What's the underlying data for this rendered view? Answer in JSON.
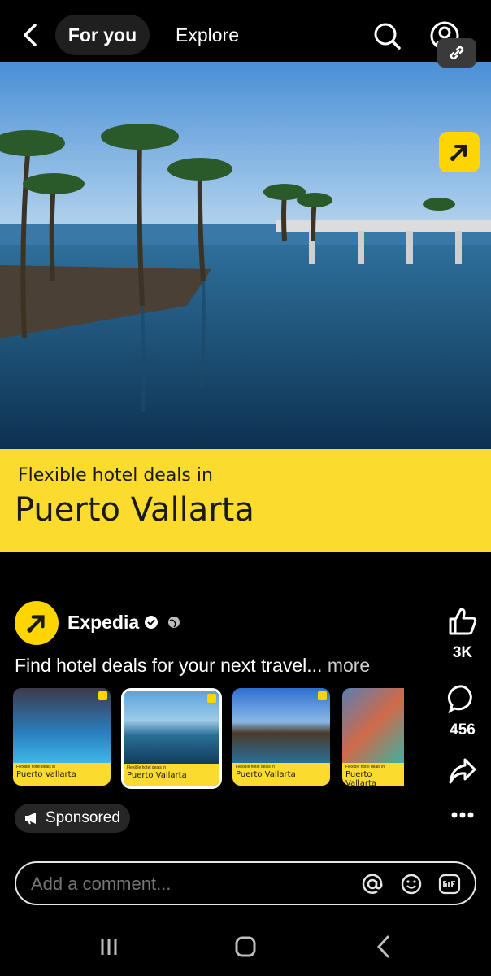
{
  "nav": {
    "tab_for_you": "For you",
    "tab_explore": "Explore"
  },
  "hero": {
    "banner_subtitle": "Flexible hotel deals in",
    "banner_title": "Puerto Vallarta"
  },
  "post": {
    "brand": "Expedia",
    "caption": "Find hotel deals for your next travel...",
    "more_label": "more",
    "likes": "3K",
    "comments": "456",
    "sponsored_label": "Sponsored"
  },
  "carousel": [
    {
      "subtitle": "Flexible hotel deals in",
      "title": "Puerto Vallarta"
    },
    {
      "subtitle": "Flexible hotel deals in",
      "title": "Puerto Vallarta"
    },
    {
      "subtitle": "Flexible hotel deals in",
      "title": "Puerto Vallarta"
    },
    {
      "subtitle": "Flexible hotel deals in",
      "title": "Puerto Vallarta"
    }
  ],
  "comment": {
    "placeholder": "Add a comment..."
  },
  "colors": {
    "brand_yellow": "#fbdb2d",
    "background": "#000000"
  }
}
